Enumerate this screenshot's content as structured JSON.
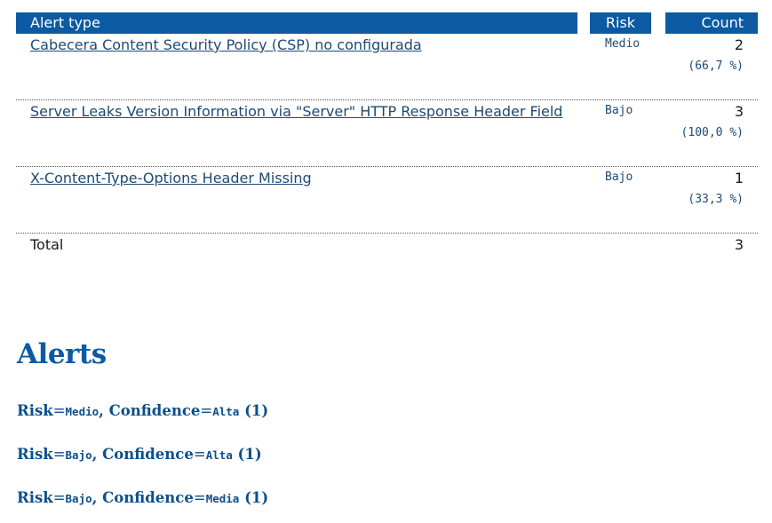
{
  "summary": {
    "headers": {
      "alert_type": "Alert type",
      "risk": "Risk",
      "count": "Count"
    },
    "rows": [
      {
        "name": "Cabecera Content Security Policy (CSP) no configurada",
        "risk": "Medio",
        "count": "2",
        "pct": "(66,7 %)"
      },
      {
        "name": "Server Leaks Version Information via \"Server\" HTTP Response Header Field",
        "risk": "Bajo",
        "count": "3",
        "pct": "(100,0 %)"
      },
      {
        "name": "X-Content-Type-Options Header Missing",
        "risk": "Bajo",
        "count": "1",
        "pct": "(33,3 %)"
      }
    ],
    "total": {
      "label": "Total",
      "count": "3"
    }
  },
  "alerts": {
    "title": "Alerts",
    "groups": [
      {
        "risk_label": "Risk",
        "eq": "=",
        "risk": "Medio",
        "sep": ", ",
        "conf_label": "Confidence",
        "conf": "Alta",
        "count": " (1)"
      },
      {
        "risk_label": "Risk",
        "eq": "=",
        "risk": "Bajo",
        "sep": ", ",
        "conf_label": "Confidence",
        "conf": "Alta",
        "count": " (1)"
      },
      {
        "risk_label": "Risk",
        "eq": "=",
        "risk": "Bajo",
        "sep": ", ",
        "conf_label": "Confidence",
        "conf": "Media",
        "count": " (1)"
      }
    ]
  },
  "colors": {
    "header_bg": "#0b5aa2",
    "link": "#1f4a73",
    "heading": "#0b5aa2"
  }
}
